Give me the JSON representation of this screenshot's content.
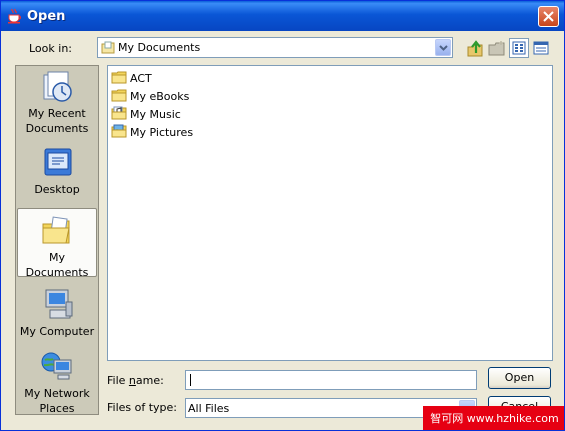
{
  "window": {
    "title": "Open",
    "title_icon": "java-cup-icon",
    "close_icon": "close-icon"
  },
  "toolbar": {
    "lookin_label": "Look in:",
    "lookin_value": "My Documents",
    "buttons": [
      "up-one-level-icon",
      "new-folder-icon",
      "list-view-icon",
      "details-view-icon"
    ]
  },
  "places": [
    {
      "label": "My Recent Documents",
      "icon": "recent-documents-icon"
    },
    {
      "label": "Desktop",
      "icon": "desktop-icon"
    },
    {
      "label": "My Documents",
      "icon": "my-documents-icon",
      "selected": true
    },
    {
      "label": "My Computer",
      "icon": "my-computer-icon"
    },
    {
      "label": "My Network Places",
      "icon": "network-places-icon"
    }
  ],
  "files": [
    {
      "name": "ACT",
      "icon": "folder-icon"
    },
    {
      "name": "My eBooks",
      "icon": "folder-icon"
    },
    {
      "name": "My Music",
      "icon": "music-folder-icon"
    },
    {
      "name": "My Pictures",
      "icon": "pictures-folder-icon"
    }
  ],
  "footer": {
    "filename_label_pre": "File ",
    "filename_label_mnemonic": "n",
    "filename_label_post": "ame:",
    "filename_value": "",
    "filetype_label": "Files of type:",
    "filetype_value": "All Files",
    "open_label": "Open",
    "cancel_label": "Cancel"
  },
  "watermark": "智可网 www.hzhike.com",
  "colors": {
    "titlebar": "#0a56d6",
    "dialog_bg": "#ece9d8",
    "places_bg": "#cccab9",
    "close_button": "#d8522e",
    "watermark_bg": "#e60012"
  }
}
